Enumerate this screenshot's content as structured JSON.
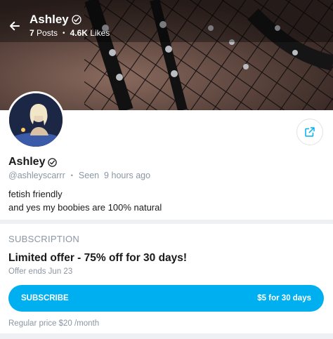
{
  "header": {
    "name": "Ashley",
    "posts_count": "7",
    "posts_label": "Posts",
    "likes_count": "4.6K",
    "likes_label": "Likes"
  },
  "profile": {
    "name": "Ashley",
    "handle": "@ashleyscarrr",
    "last_seen": "Seen  9 hours ago",
    "bio_line_1": "fetish friendly",
    "bio_line_2": "and yes my boobies are 100% natural"
  },
  "subscription": {
    "section_title": "SUBSCRIPTION",
    "offer_title": "Limited offer - 75% off for 30 days!",
    "offer_ends": "Offer ends Jun 23",
    "button_label": "SUBSCRIBE",
    "button_price": "$5 for 30 days",
    "regular_price": "Regular price $20 /month"
  },
  "colors": {
    "accent": "#00aff0",
    "muted_text": "#8a96a3"
  },
  "icons": [
    "back-arrow-icon",
    "verified-check-icon",
    "share-icon"
  ]
}
